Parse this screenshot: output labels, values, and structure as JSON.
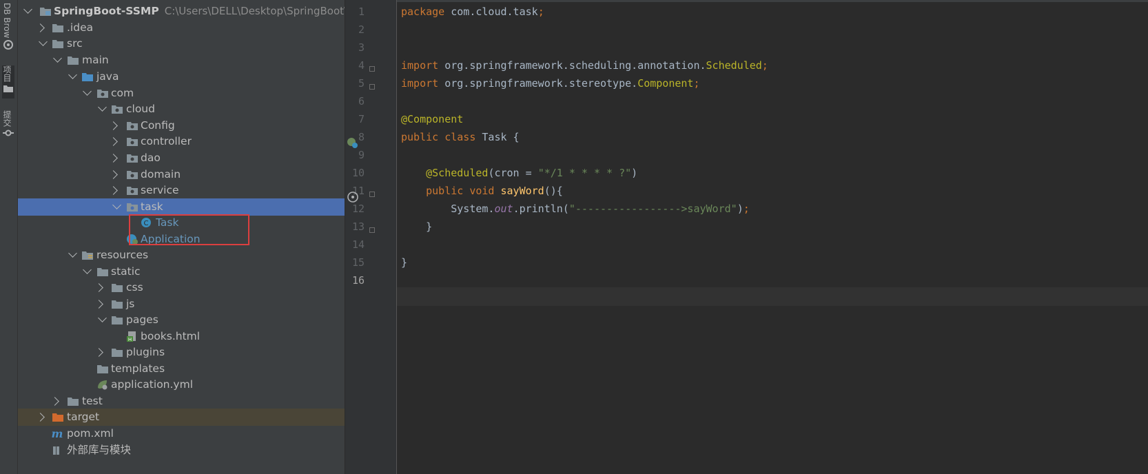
{
  "sidebar": {
    "tools": [
      {
        "label": "DB Brow"
      },
      {
        "label": "项目"
      },
      {
        "label": "提交"
      }
    ]
  },
  "project_tree": {
    "root": {
      "name": "SpringBoot-SSMP",
      "path": "C:\\Users\\DELL\\Desktop\\SpringBoot\\Sp"
    },
    "items": [
      {
        "name": ".idea"
      },
      {
        "name": "src"
      },
      {
        "name": "main"
      },
      {
        "name": "java"
      },
      {
        "name": "com"
      },
      {
        "name": "cloud"
      },
      {
        "name": "Config"
      },
      {
        "name": "controller"
      },
      {
        "name": "dao"
      },
      {
        "name": "domain"
      },
      {
        "name": "service"
      },
      {
        "name": "task"
      },
      {
        "name": "Task"
      },
      {
        "name": "Application"
      },
      {
        "name": "resources"
      },
      {
        "name": "static"
      },
      {
        "name": "css"
      },
      {
        "name": "js"
      },
      {
        "name": "pages"
      },
      {
        "name": "books.html"
      },
      {
        "name": "plugins"
      },
      {
        "name": "templates"
      },
      {
        "name": "application.yml"
      },
      {
        "name": "test"
      },
      {
        "name": "target"
      },
      {
        "name": "pom.xml"
      },
      {
        "name": "外部库与模块"
      }
    ]
  },
  "editor": {
    "lines": [
      {
        "n": "1",
        "tokens": [
          {
            "t": "package ",
            "c": "kw"
          },
          {
            "t": "com.cloud.task",
            "c": ""
          },
          {
            "t": ";",
            "c": "kw"
          }
        ]
      },
      {
        "n": "2",
        "tokens": []
      },
      {
        "n": "3",
        "tokens": []
      },
      {
        "n": "4",
        "tokens": [
          {
            "t": "import ",
            "c": "kw"
          },
          {
            "t": "org.springframework.scheduling.annotation.",
            "c": ""
          },
          {
            "t": "Scheduled",
            "c": "ann"
          },
          {
            "t": ";",
            "c": "kw"
          }
        ]
      },
      {
        "n": "5",
        "tokens": [
          {
            "t": "import ",
            "c": "kw"
          },
          {
            "t": "org.springframework.stereotype.",
            "c": ""
          },
          {
            "t": "Component",
            "c": "ann"
          },
          {
            "t": ";",
            "c": "kw"
          }
        ]
      },
      {
        "n": "6",
        "tokens": []
      },
      {
        "n": "7",
        "tokens": [
          {
            "t": "@Component",
            "c": "ann"
          }
        ]
      },
      {
        "n": "8",
        "tokens": [
          {
            "t": "public class ",
            "c": "kw"
          },
          {
            "t": "Task {",
            "c": ""
          }
        ]
      },
      {
        "n": "9",
        "tokens": []
      },
      {
        "n": "10",
        "tokens": [
          {
            "t": "    ",
            "c": ""
          },
          {
            "t": "@Scheduled",
            "c": "ann"
          },
          {
            "t": "(cron = ",
            "c": ""
          },
          {
            "t": "\"*/1 * * * * ?\"",
            "c": "str"
          },
          {
            "t": ")",
            "c": ""
          }
        ]
      },
      {
        "n": "11",
        "tokens": [
          {
            "t": "    ",
            "c": ""
          },
          {
            "t": "public void ",
            "c": "kw"
          },
          {
            "t": "sayWord",
            "c": "fn"
          },
          {
            "t": "(){",
            "c": ""
          }
        ]
      },
      {
        "n": "12",
        "tokens": [
          {
            "t": "        System.",
            "c": ""
          },
          {
            "t": "out",
            "c": "fld"
          },
          {
            "t": ".println(",
            "c": ""
          },
          {
            "t": "\"----------------->sayWord\"",
            "c": "str"
          },
          {
            "t": ")",
            "c": ""
          },
          {
            "t": ";",
            "c": "kw"
          }
        ]
      },
      {
        "n": "13",
        "tokens": [
          {
            "t": "    }",
            "c": ""
          }
        ]
      },
      {
        "n": "14",
        "tokens": []
      },
      {
        "n": "15",
        "tokens": [
          {
            "t": "}",
            "c": ""
          }
        ]
      },
      {
        "n": "16",
        "tokens": []
      }
    ]
  }
}
